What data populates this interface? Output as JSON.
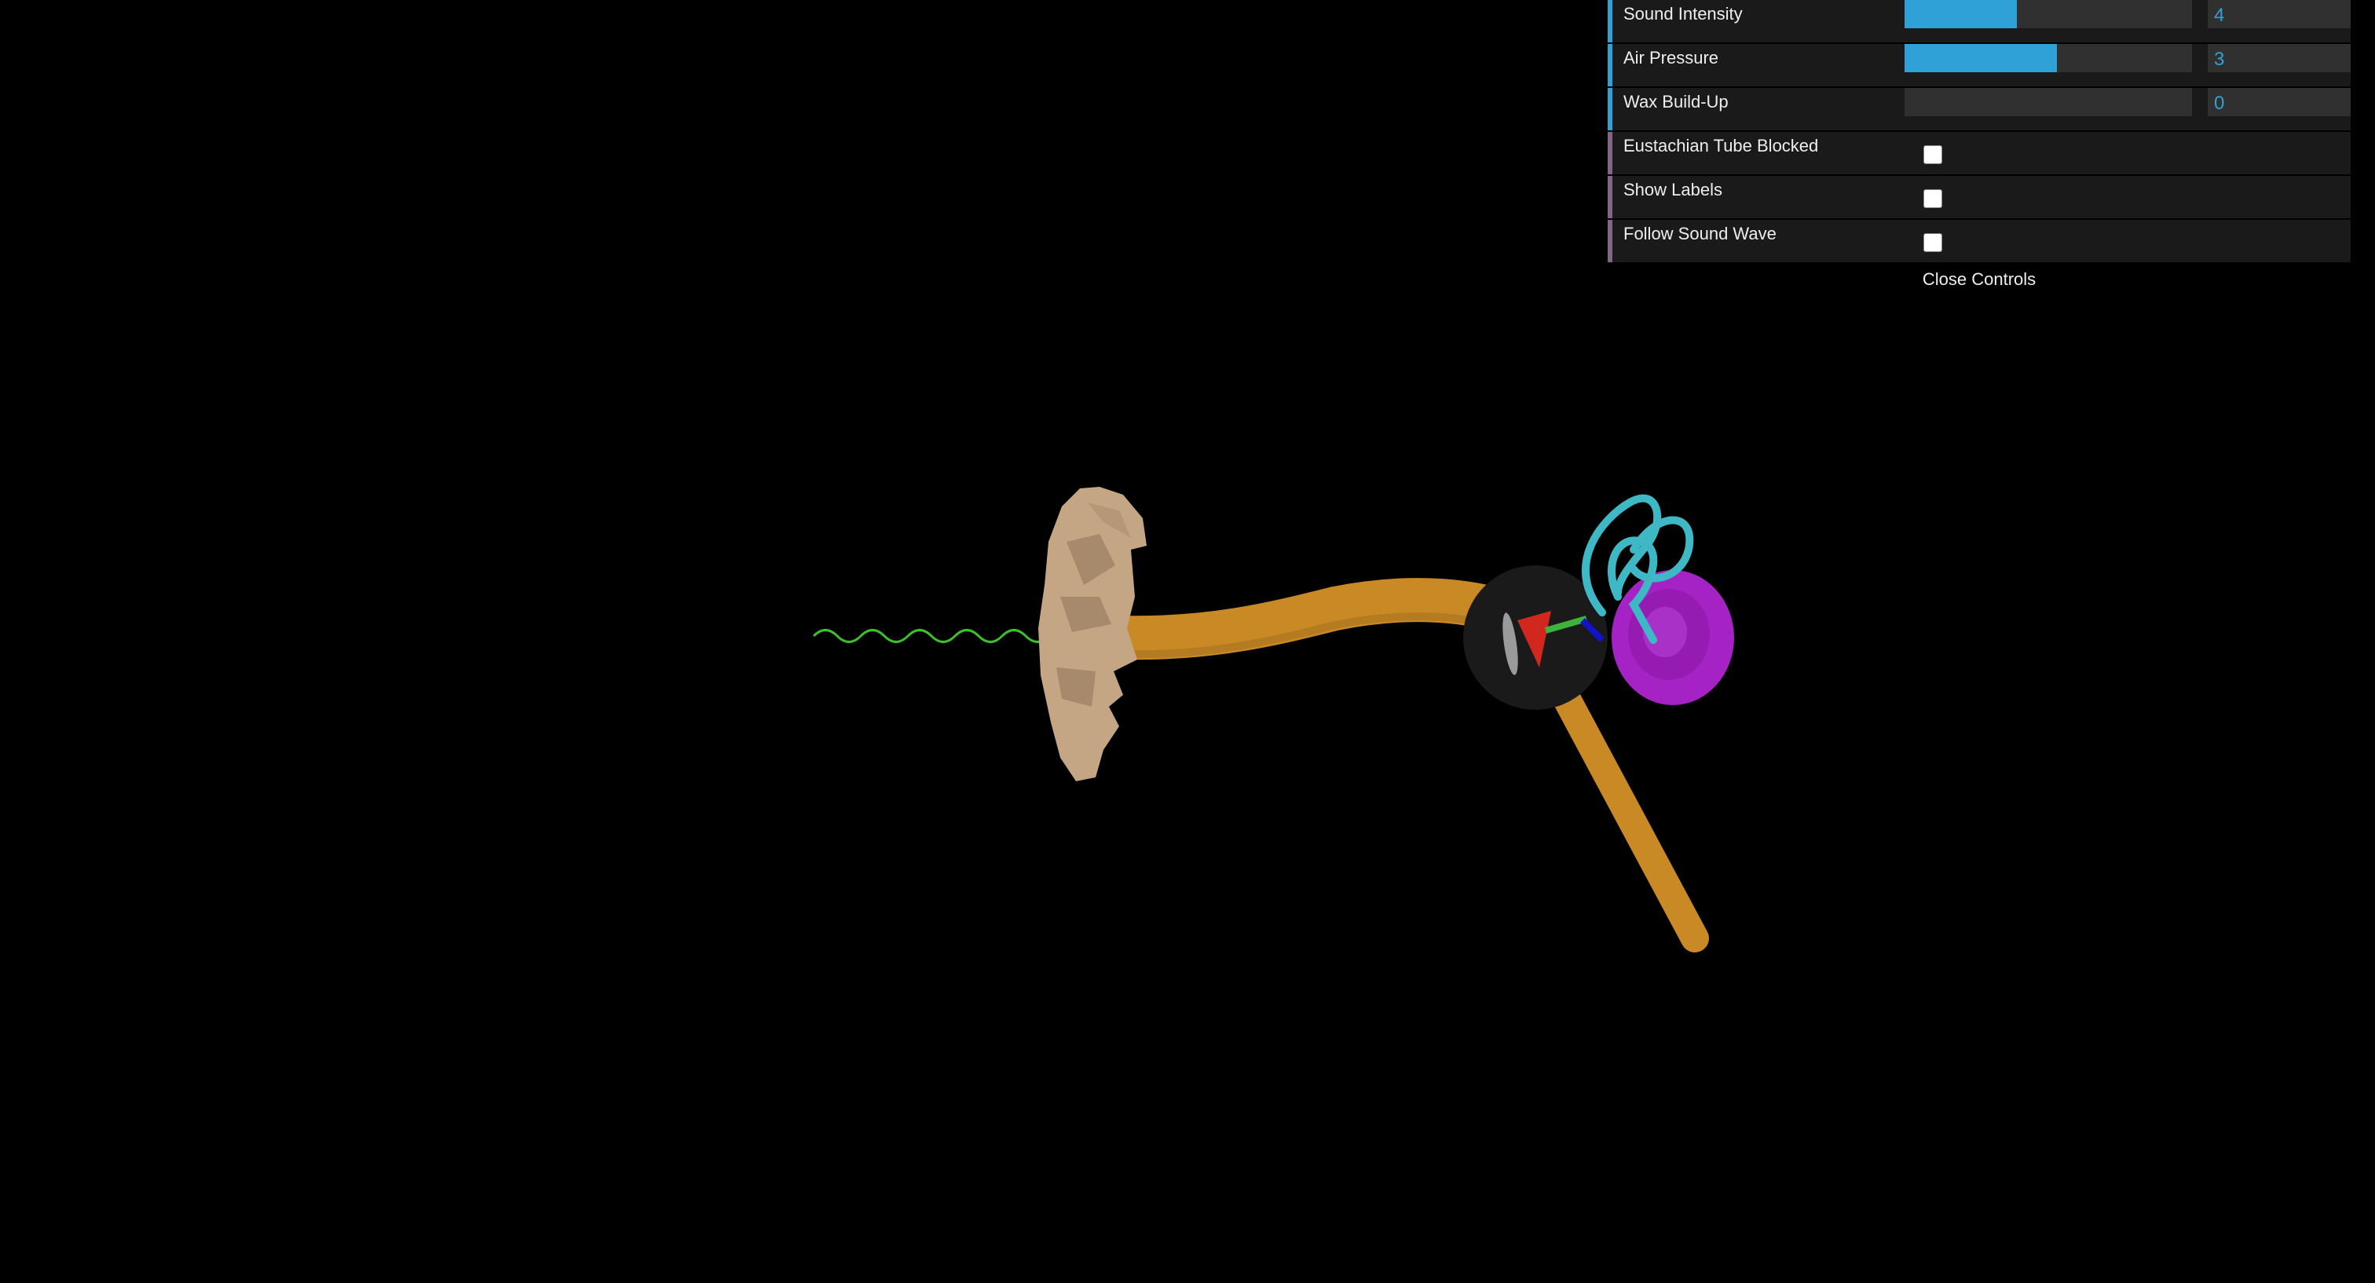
{
  "controls": {
    "sliders": [
      {
        "label": "Sound Intensity",
        "value": "4",
        "fill": 0.39
      },
      {
        "label": "Air Pressure",
        "value": "3",
        "fill": 0.53
      },
      {
        "label": "Wax Build-Up",
        "value": "0",
        "fill": 0
      }
    ],
    "toggles": [
      {
        "label": "Eustachian Tube Blocked",
        "checked": false
      },
      {
        "label": "Show Labels",
        "checked": false
      },
      {
        "label": "Follow Sound Wave",
        "checked": false
      }
    ],
    "close_label": "Close Controls"
  },
  "colors": {
    "background": "#000000",
    "panel": "#1a1a1a",
    "slider_track": "#303030",
    "accent": "#2fa1d6",
    "sound_wave": "#3bbf2b",
    "outer_ear": "#c4a584",
    "ear_canal": "#c98a25",
    "eardrum": "#9a9a9a",
    "ossicle": "#d0281e",
    "cochlea": "#a523c4",
    "semicircular_canals": "#3fb8c6",
    "middle_ear": "#1a1a1a",
    "nerve_blue": "#1212c8",
    "stapes_green": "#3cb43c",
    "eustachian_tube": "#c98a25"
  }
}
